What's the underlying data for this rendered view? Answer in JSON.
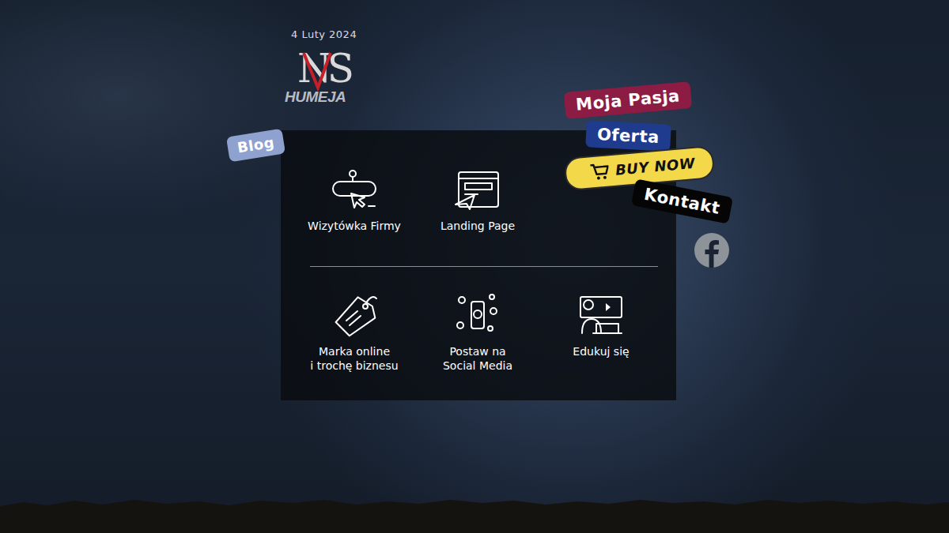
{
  "date": "4 Luty 2024",
  "logo": {
    "letters": "NS",
    "name": "HUMEJA"
  },
  "blog": "Blog",
  "services": [
    [
      {
        "label": "Wizytówka Firmy",
        "kind": "www"
      },
      {
        "label": "Landing Page",
        "kind": "landing"
      }
    ],
    [
      {
        "label": "Marka online\ni trochę biznesu",
        "kind": "tag"
      },
      {
        "label": "Postaw na\nSocial Media",
        "kind": "social"
      },
      {
        "label": "Edukuj się",
        "kind": "edu"
      }
    ]
  ],
  "nav": [
    {
      "label": "Moja Pasja",
      "color": "#8c1c44",
      "kind": "link"
    },
    {
      "label": "Oferta",
      "color": "#1e3b8e",
      "kind": "link"
    },
    {
      "label": "BUY NOW",
      "color": "#f3d94a",
      "kind": "cart"
    },
    {
      "label": "Kontakt",
      "color": "#050505",
      "kind": "link"
    }
  ]
}
